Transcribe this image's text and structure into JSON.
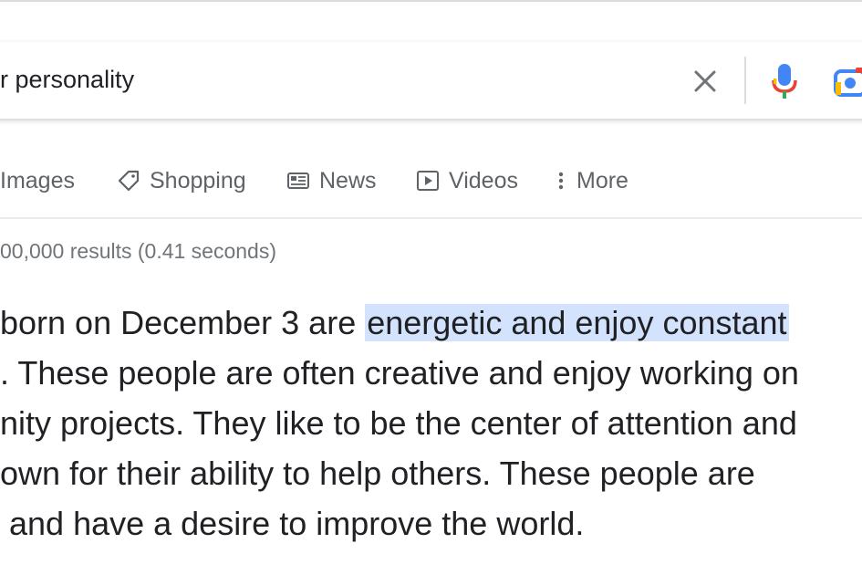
{
  "search": {
    "query": "r personality"
  },
  "tabs": [
    {
      "label": "Images",
      "icon": "none"
    },
    {
      "label": "Shopping",
      "icon": "tag-icon"
    },
    {
      "label": "News",
      "icon": "news-icon"
    },
    {
      "label": "Videos",
      "icon": "play-icon"
    },
    {
      "label": "More",
      "icon": "more-vert-icon"
    }
  ],
  "results": {
    "stats": "00,000 results (0.41 seconds)"
  },
  "snippet": {
    "line1_pre": "born on December 3 are ",
    "line1_highlight": "energetic and enjoy constant",
    "line2": ". These people are often creative and enjoy working on",
    "line3": "nity projects. They like to be the center of attention and",
    "line4": "own for their ability to help others. These people are",
    "line5": "and have a desire to improve the world."
  },
  "colors": {
    "highlight": "#d3e3fd",
    "mic_blue": "#4285f4",
    "mic_red": "#ea4335",
    "mic_yellow": "#fbbc04",
    "mic_green": "#34a853"
  }
}
